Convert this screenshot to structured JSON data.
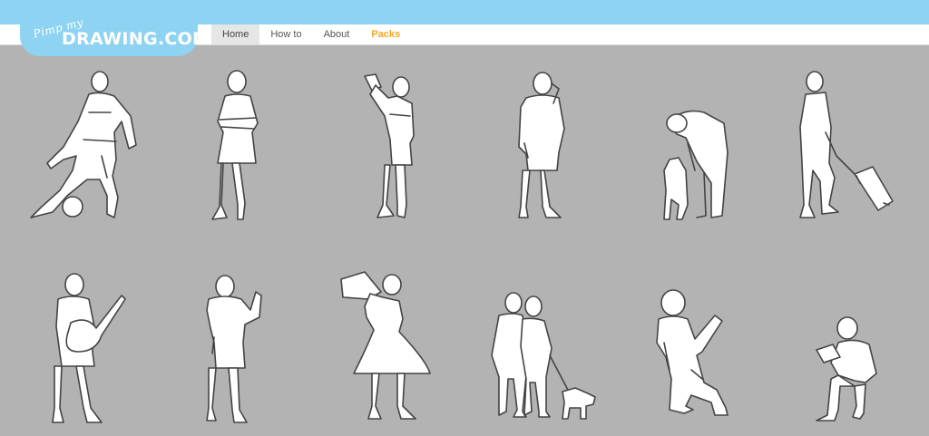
{
  "logo": {
    "script_text": "Pimp my",
    "main_text": "DRAWING.COM"
  },
  "nav": {
    "items": [
      {
        "label": "Home",
        "state": "active"
      },
      {
        "label": "How to",
        "state": "default"
      },
      {
        "label": "About",
        "state": "default"
      },
      {
        "label": "Packs",
        "state": "highlight"
      }
    ]
  },
  "colors": {
    "topbar": "#8fd3f3",
    "canvas": "#b3b3b3",
    "packs_accent": "#f5a623",
    "figure_fill": "#ffffff",
    "figure_outline": "#444444"
  },
  "figures": [
    {
      "icon": "soccer-player-figure-icon"
    },
    {
      "icon": "woman-arms-crossed-figure-icon"
    },
    {
      "icon": "woman-taking-selfie-figure-icon"
    },
    {
      "icon": "man-on-phone-figure-icon"
    },
    {
      "icon": "person-petting-dog-figure-icon"
    },
    {
      "icon": "man-with-suitcase-figure-icon"
    },
    {
      "icon": "man-with-guitar-figure-icon"
    },
    {
      "icon": "man-thumbs-up-figure-icon"
    },
    {
      "icon": "woman-with-megaphone-figure-icon"
    },
    {
      "icon": "couple-walking-dog-figure-icon"
    },
    {
      "icon": "woman-sitting-talking-figure-icon"
    },
    {
      "icon": "man-sitting-reading-figure-icon"
    }
  ]
}
